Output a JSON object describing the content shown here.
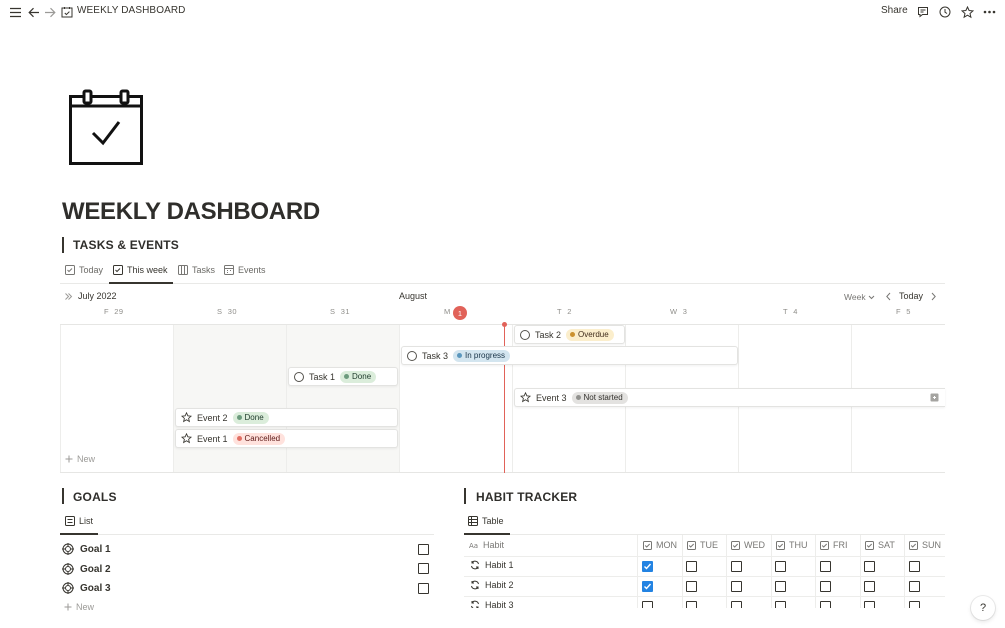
{
  "topbar": {
    "title": "WEEKLY DASHBOARD",
    "share_label": "Share",
    "icons": [
      "menu-icon",
      "back-arrow-icon",
      "forward-arrow-icon",
      "page-calendar-icon",
      "comment-icon",
      "history-icon",
      "star-icon",
      "more-icon"
    ]
  },
  "page": {
    "title": "WEEKLY DASHBOARD",
    "icon": "calendar-check-icon"
  },
  "tasks_events": {
    "heading": "TASKS & EVENTS",
    "tabs": [
      {
        "label": "Today",
        "active": false
      },
      {
        "label": "This week",
        "active": true
      },
      {
        "label": "Tasks",
        "active": false
      },
      {
        "label": "Events",
        "active": false
      }
    ],
    "calendar": {
      "month_left": "July 2022",
      "month_center": "August",
      "view_select": "Week",
      "today_button": "Today",
      "day_labels": [
        {
          "letter": "F",
          "num": "29"
        },
        {
          "letter": "S",
          "num": "30"
        },
        {
          "letter": "S",
          "num": "31"
        },
        {
          "letter": "M",
          "num": "1"
        },
        {
          "letter": "T",
          "num": "2"
        },
        {
          "letter": "W",
          "num": "3"
        },
        {
          "letter": "T",
          "num": "4"
        },
        {
          "letter": "F",
          "num": "5"
        }
      ],
      "items": [
        {
          "name": "Task 2",
          "status": "Overdue",
          "color": "#cb912f",
          "kind": "task"
        },
        {
          "name": "Task 3",
          "status": "In progress",
          "color": "#5b97bd",
          "kind": "task"
        },
        {
          "name": "Task 1",
          "status": "Done",
          "color": "#6c9b7d",
          "kind": "task"
        },
        {
          "name": "Event 3",
          "status": "Not started",
          "color": "#91918e",
          "kind": "event"
        },
        {
          "name": "Event 2",
          "status": "Done",
          "color": "#6c9b7d",
          "kind": "event"
        },
        {
          "name": "Event 1",
          "status": "Cancelled",
          "color": "#e16f64",
          "kind": "event"
        }
      ],
      "new_label": "New"
    }
  },
  "goals": {
    "heading": "GOALS",
    "view_tab": "List",
    "items": [
      {
        "name": "Goal 1",
        "checked": false
      },
      {
        "name": "Goal 2",
        "checked": false
      },
      {
        "name": "Goal 3",
        "checked": false
      }
    ],
    "new_label": "New"
  },
  "habit_tracker": {
    "heading": "HABIT TRACKER",
    "view_tab": "Table",
    "columns": [
      "Habit",
      "MON",
      "TUE",
      "WED",
      "THU",
      "FRI",
      "SAT",
      "SUN"
    ],
    "rows": [
      {
        "name": "Habit 1",
        "values": [
          true,
          false,
          false,
          false,
          false,
          false,
          false
        ]
      },
      {
        "name": "Habit 2",
        "values": [
          true,
          false,
          false,
          false,
          false,
          false,
          false
        ]
      },
      {
        "name": "Habit 3",
        "values": [
          false,
          false,
          false,
          false,
          false,
          false,
          false
        ]
      }
    ]
  },
  "help_label": "?"
}
